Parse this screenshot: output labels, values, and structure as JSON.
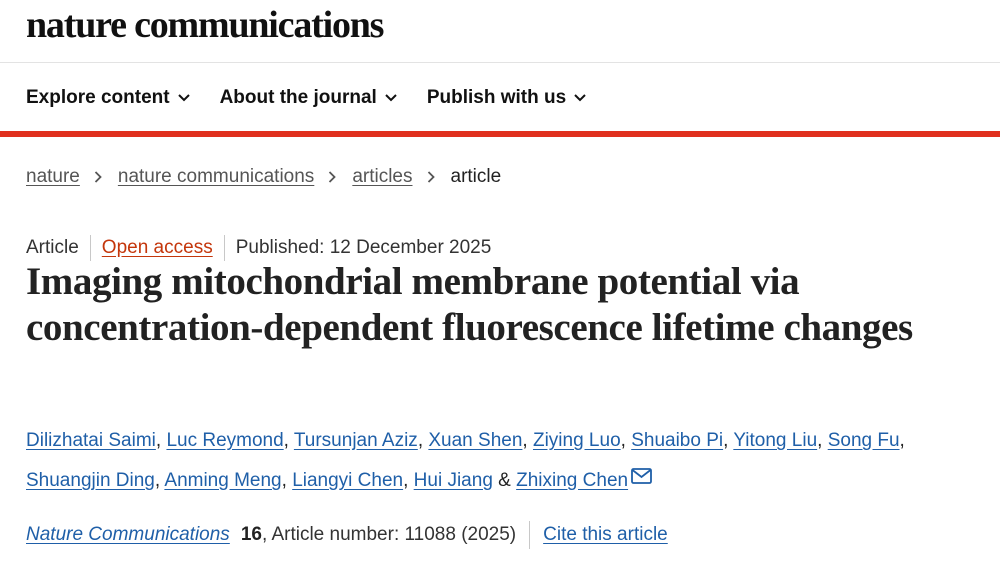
{
  "header": {
    "brand": "nature communications"
  },
  "nav": {
    "items": [
      {
        "label": "Explore content"
      },
      {
        "label": "About the journal"
      },
      {
        "label": "Publish with us"
      }
    ]
  },
  "breadcrumb": {
    "items": [
      "nature",
      "nature communications",
      "articles"
    ],
    "current": "article"
  },
  "meta": {
    "type": "Article",
    "access": "Open access",
    "published": "Published: 12 December 2025"
  },
  "article": {
    "title": "Imaging mitochondrial membrane potential via concentration-dependent fluorescence lifetime changes"
  },
  "authors": [
    "Dilizhatai Saimi",
    "Luc Reymond",
    "Tursunjan Aziz",
    "Xuan Shen",
    "Ziying Luo",
    "Shuaibo Pi",
    "Yitong Liu",
    "Song Fu",
    "Shuangjin Ding",
    "Anming Meng",
    "Liangyi Chen",
    "Hui Jiang",
    "Zhixing Chen"
  ],
  "citation": {
    "journal": "Nature Communications",
    "volume": "16",
    "article_number": ", Article number: 11088 (2025)",
    "cite_label": "Cite this article"
  },
  "colors": {
    "accent_red": "#e0301e",
    "link_blue": "#1f5fa8",
    "open_access": "#c4360b"
  },
  "icons": {
    "nav_dropdown": "chevron-down-icon",
    "breadcrumb_separator": "chevron-right-icon",
    "corresponding_author": "mail-icon"
  }
}
